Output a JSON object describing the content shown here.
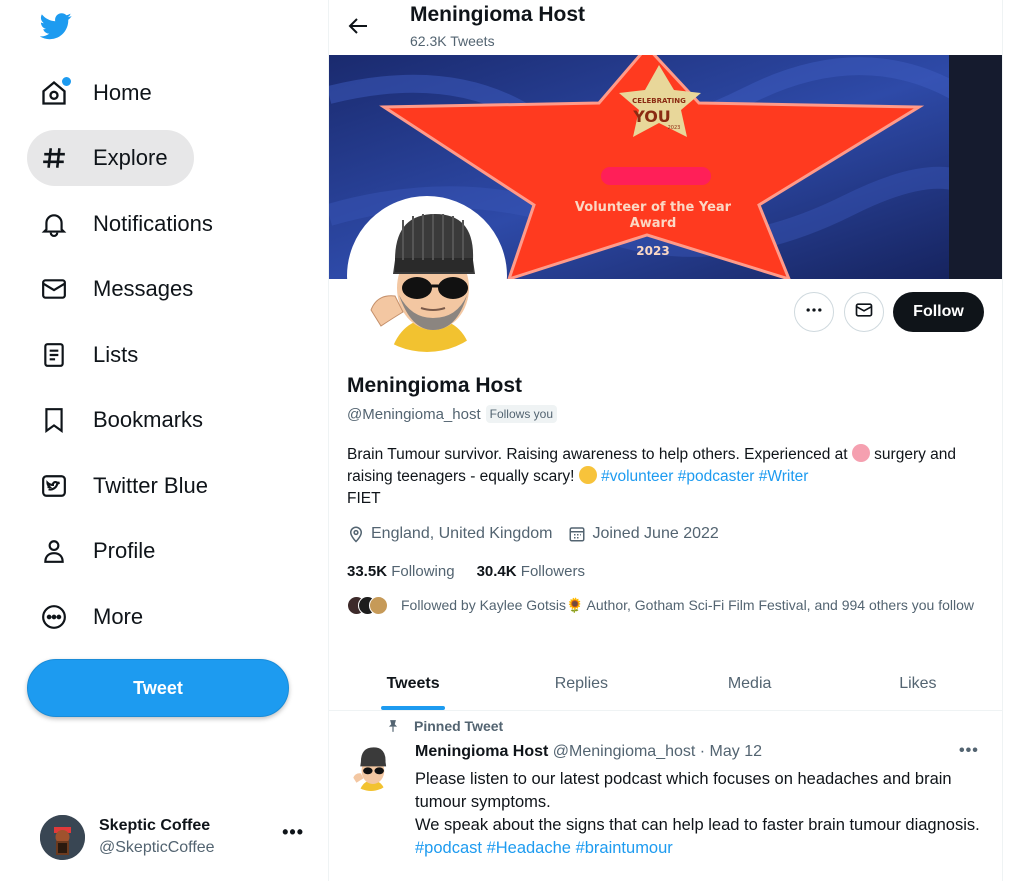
{
  "sidebar": {
    "logo_icon": "twitter-bird-icon",
    "items": [
      {
        "label": "Home",
        "icon": "home-icon"
      },
      {
        "label": "Explore",
        "icon": "hashtag-icon"
      },
      {
        "label": "Notifications",
        "icon": "bell-icon"
      },
      {
        "label": "Messages",
        "icon": "envelope-icon"
      },
      {
        "label": "Lists",
        "icon": "list-icon"
      },
      {
        "label": "Bookmarks",
        "icon": "bookmark-icon"
      },
      {
        "label": "Twitter Blue",
        "icon": "twitter-blue-icon"
      },
      {
        "label": "Profile",
        "icon": "person-icon"
      },
      {
        "label": "More",
        "icon": "more-circle-icon"
      }
    ],
    "active_item": "Explore",
    "tweet_button": "Tweet",
    "account": {
      "name": "Skeptic Coffee",
      "handle": "@SkepticCoffee",
      "more": "•••"
    }
  },
  "header": {
    "title": "Meningioma Host",
    "subtitle": "62.3K Tweets"
  },
  "banner": {
    "badge_line1": "CELEBRATING",
    "badge_line2": "YOU",
    "badge_line3": "2023",
    "award_line1": "Volunteer of the Year",
    "award_line2": "Award",
    "award_year": "2023"
  },
  "profile": {
    "name": "Meningioma Host",
    "handle": "@Meningioma_host",
    "follows_you": "Follows you",
    "follow_button": "Follow",
    "bio_text_1": "Brain Tumour survivor. Raising awareness to help others. Experienced at ",
    "bio_text_2": " surgery and raising teenagers - equally scary! ",
    "bio_tag_1": "#volunteer",
    "bio_tag_2": "#podcaster",
    "bio_tag_3": "#Writer",
    "bio_text_3": "FIET",
    "location": "England, United Kingdom",
    "joined": "Joined June 2022",
    "following_count": "33.5K",
    "following_label": "Following",
    "followers_count": "30.4K",
    "followers_label": "Followers",
    "followed_by": "Followed by Kaylee Gotsis🌻 Author, Gotham Sci-Fi Film Festival, and 994 others you follow"
  },
  "tabs": [
    {
      "label": "Tweets",
      "active": true
    },
    {
      "label": "Replies",
      "active": false
    },
    {
      "label": "Media",
      "active": false
    },
    {
      "label": "Likes",
      "active": false
    }
  ],
  "pinned_tweet": {
    "pinned_label": "Pinned Tweet",
    "name": "Meningioma Host",
    "meta": "@Meningioma_host · May 12",
    "more": "•••",
    "line1": "Please listen to our latest podcast which focuses on headaches and brain tumour symptoms.",
    "line2": "We speak about the signs that can help lead to faster brain tumour diagnosis.",
    "tag1": "#podcast",
    "tag2": "#Headache",
    "tag3": "#braintumour"
  },
  "colors": {
    "accent": "#1d9bf0",
    "text": "#0f1419",
    "muted": "#536471",
    "banner_star": "#f4381e"
  }
}
